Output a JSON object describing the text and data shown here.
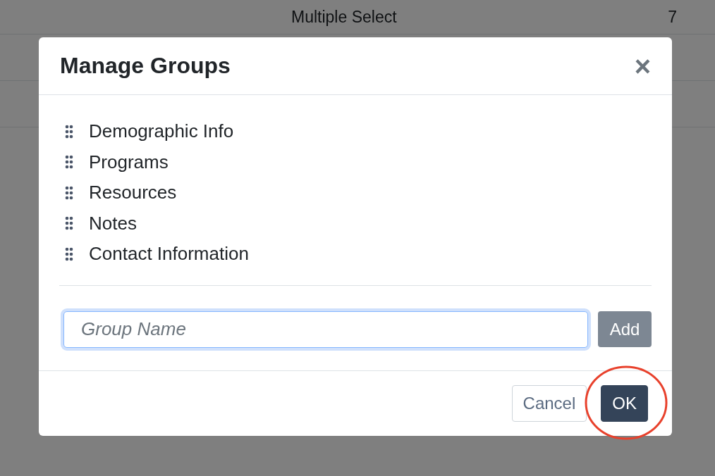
{
  "background_table": {
    "rows": [
      {
        "column_1": "Multiple Select",
        "column_2": "7"
      }
    ]
  },
  "dialog": {
    "title": "Manage Groups",
    "close": "×",
    "groups": [
      {
        "label": "Demographic Info"
      },
      {
        "label": "Programs"
      },
      {
        "label": "Resources"
      },
      {
        "label": "Notes"
      },
      {
        "label": "Contact Information"
      }
    ],
    "input": {
      "placeholder": "Group Name",
      "focused": true
    },
    "add_button": "Add",
    "buttons": [
      {
        "label": "Cancel",
        "kind": "secondary",
        "highlighted": false
      },
      {
        "label": "OK",
        "kind": "primary",
        "highlighted": true
      }
    ]
  }
}
